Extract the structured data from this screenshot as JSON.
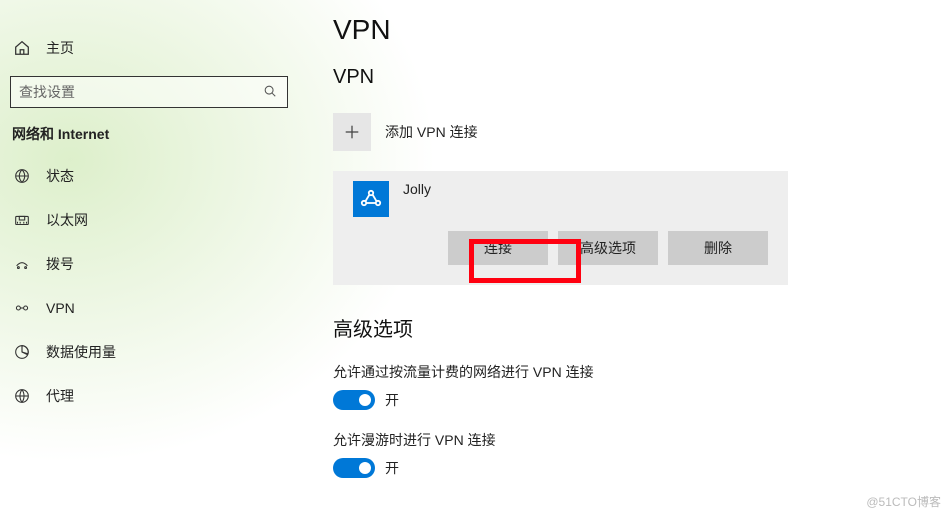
{
  "sidebar": {
    "home_label": "主页",
    "search_placeholder": "查找设置",
    "section_label": "网络和 Internet",
    "items": [
      {
        "label": "状态"
      },
      {
        "label": "以太网"
      },
      {
        "label": "拨号"
      },
      {
        "label": "VPN"
      },
      {
        "label": "数据使用量"
      },
      {
        "label": "代理"
      }
    ]
  },
  "main": {
    "page_title": "VPN",
    "section_vpn": "VPN",
    "add_label": "添加 VPN 连接",
    "vpn_entry": {
      "name": "Jolly",
      "actions": {
        "connect": "连接",
        "advanced": "高级选项",
        "delete": "删除"
      }
    },
    "advanced_title": "高级选项",
    "option_metered": {
      "label": "允许通过按流量计费的网络进行 VPN 连接",
      "state": "开"
    },
    "option_roaming": {
      "label": "允许漫游时进行 VPN 连接",
      "state": "开"
    }
  },
  "watermark": "@51CTO博客"
}
